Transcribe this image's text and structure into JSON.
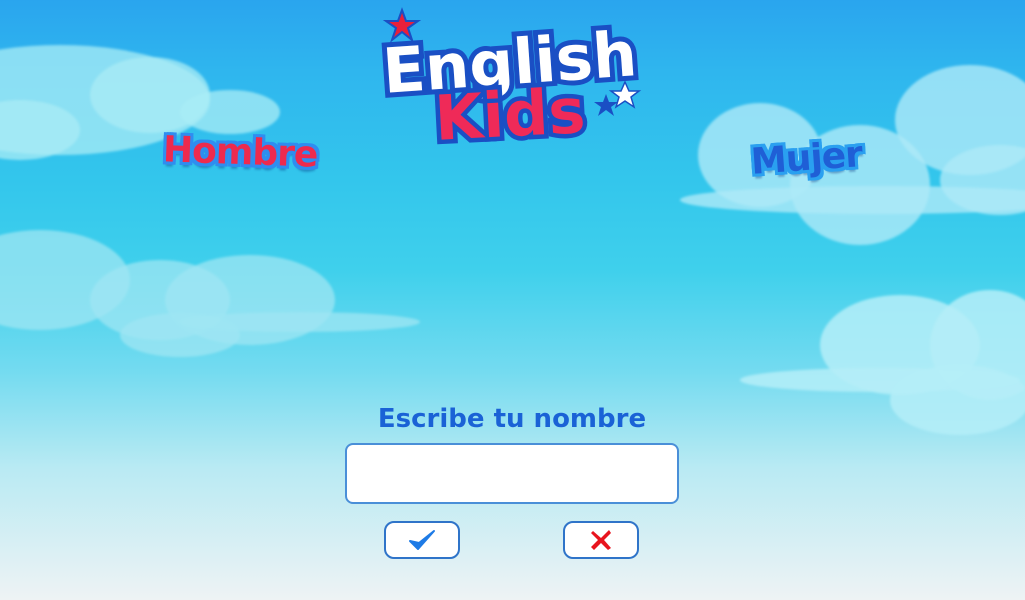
{
  "logo": {
    "line1": "English",
    "line2": "Kids"
  },
  "gender": {
    "male_label": "Hombre",
    "female_label": "Mujer"
  },
  "form": {
    "prompt": "Escribe tu nombre",
    "name_value": "",
    "confirm_icon": "check-icon",
    "cancel_icon": "close-icon"
  },
  "colors": {
    "male": "#ee2a4e",
    "female": "#1f5fd6",
    "prompt": "#1a62d6",
    "confirm": "#1e7be6",
    "cancel": "#e8141e"
  }
}
